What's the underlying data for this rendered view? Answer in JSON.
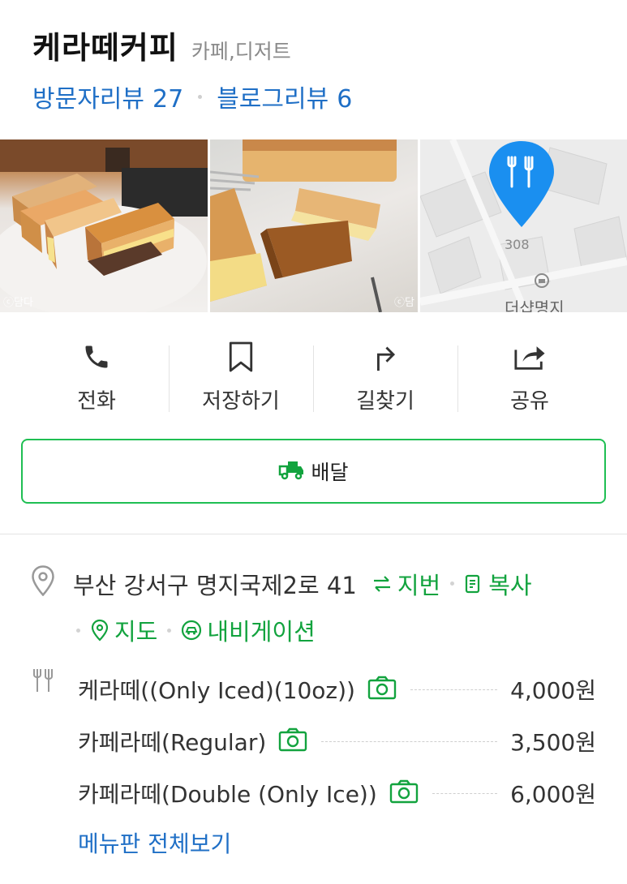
{
  "place": {
    "name": "케라떼커피",
    "category": "카페,디저트",
    "visitor_review_label": "방문자리뷰",
    "visitor_review_count": "27",
    "blog_review_label": "블로그리뷰",
    "blog_review_count": "6"
  },
  "photos": {
    "photo1_credit": "ⓒ담다",
    "photo2_credit": "ⓒ담",
    "map_number": "308",
    "map_place_label": "더샵명지"
  },
  "actions": [
    {
      "label": "전화",
      "icon": "phone-icon"
    },
    {
      "label": "저장하기",
      "icon": "bookmark-icon"
    },
    {
      "label": "길찾기",
      "icon": "directions-icon"
    },
    {
      "label": "공유",
      "icon": "share-icon"
    }
  ],
  "delivery": {
    "label": "배달",
    "icon": "delivery-truck-icon"
  },
  "address": {
    "text": "부산 강서구 명지국제2로 41",
    "lot_label": "지번",
    "copy_label": "복사",
    "map_label": "지도",
    "navigation_label": "내비게이션"
  },
  "menu": {
    "items": [
      {
        "name": "케라떼((Only Iced)(10oz))",
        "price": "4,000원"
      },
      {
        "name": "카페라떼(Regular)",
        "price": "3,500원"
      },
      {
        "name": "카페라떼(Double (Only Ice))",
        "price": "6,000원"
      }
    ],
    "view_all_label": "메뉴판 전체보기"
  },
  "colors": {
    "green": "#12a33e",
    "delivery_border": "#1fbf53",
    "blue": "#1f6fc6",
    "map_pin": "#1a8ff0"
  }
}
